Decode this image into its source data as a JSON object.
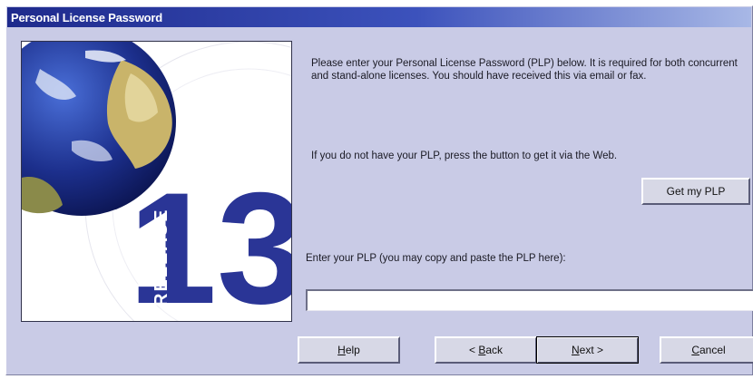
{
  "window": {
    "title": "Personal License Password"
  },
  "brand": {
    "release_word": "RELEASE",
    "release_number": "13",
    "colors": {
      "release_blue": "#2a3596",
      "release_outline": "#ffffff",
      "title_bar": "#1e2a8c",
      "dialog_bg": "#c9cbe6"
    }
  },
  "content": {
    "intro": "Please enter your Personal License Password (PLP) below.  It is required for both concurrent and stand-alone licenses.  You should have received this via email or fax.",
    "hint": "If you do not have your PLP, press the button to get it via the Web.",
    "plp_label": "Enter your PLP (you may copy and paste the PLP here):",
    "plp_value": ""
  },
  "buttons": {
    "get_plp": "Get my PLP",
    "help": "Help",
    "help_mnemonic": "H",
    "back": "< Back",
    "back_mnemonic": "B",
    "next": "Next >",
    "next_mnemonic": "N",
    "cancel": "Cancel",
    "cancel_mnemonic": "C"
  }
}
